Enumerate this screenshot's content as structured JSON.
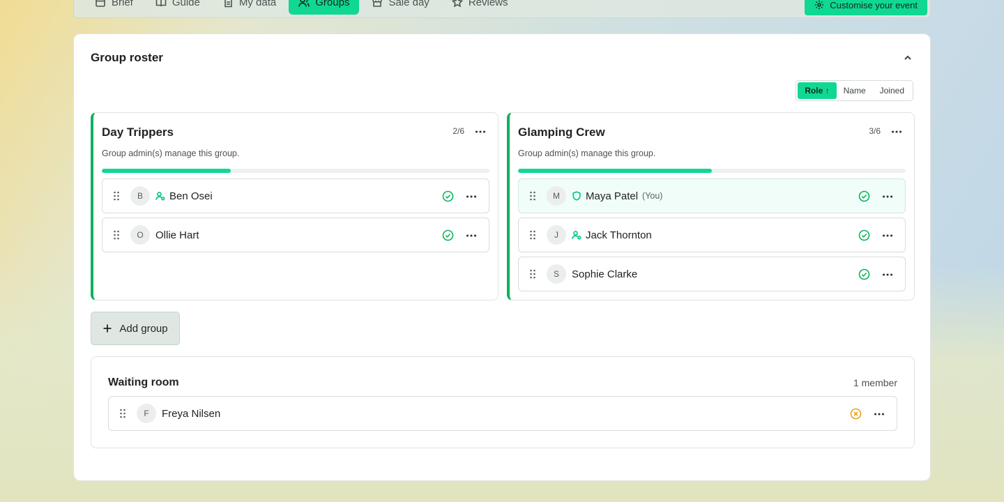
{
  "nav": {
    "tabs": [
      {
        "label": "Brief",
        "icon": "calendar-icon"
      },
      {
        "label": "Guide",
        "icon": "book-icon"
      },
      {
        "label": "My data",
        "icon": "document-icon"
      },
      {
        "label": "Groups",
        "icon": "users-icon",
        "active": true
      },
      {
        "label": "Sale day",
        "icon": "store-icon"
      },
      {
        "label": "Reviews",
        "icon": "star-icon"
      }
    ],
    "customise_label": "Customise your event"
  },
  "roster": {
    "title": "Group roster",
    "sort": {
      "options": [
        "Role ↑",
        "Name",
        "Joined"
      ],
      "active": "Role ↑"
    },
    "groups": [
      {
        "name": "Day Trippers",
        "count": "2/6",
        "fill": 0.333,
        "description": "Group admin(s) manage this group.",
        "members": [
          {
            "initial": "B",
            "name": "Ben Osei",
            "role_icon": "user-admin-icon",
            "status": "confirmed"
          },
          {
            "initial": "O",
            "name": "Ollie Hart",
            "status": "confirmed"
          }
        ]
      },
      {
        "name": "Glamping Crew",
        "count": "3/6",
        "fill": 0.5,
        "description": "Group admin(s) manage this group.",
        "members": [
          {
            "initial": "M",
            "name": "Maya Patel",
            "you": "(You)",
            "role_icon": "shield-icon",
            "status": "confirmed"
          },
          {
            "initial": "J",
            "name": "Jack Thornton",
            "role_icon": "user-admin-icon",
            "status": "confirmed"
          },
          {
            "initial": "S",
            "name": "Sophie Clarke",
            "status": "confirmed"
          }
        ]
      }
    ],
    "add_group_label": "Add group",
    "waiting_room": {
      "title": "Waiting room",
      "count": "1 member",
      "members": [
        {
          "initial": "F",
          "name": "Freya Nilsen",
          "status": "pending"
        }
      ]
    }
  },
  "colors": {
    "accent": "#10d893",
    "group_border": "#0bb35c",
    "confirmed": "#0bb35c",
    "pending": "#e8a21a"
  }
}
